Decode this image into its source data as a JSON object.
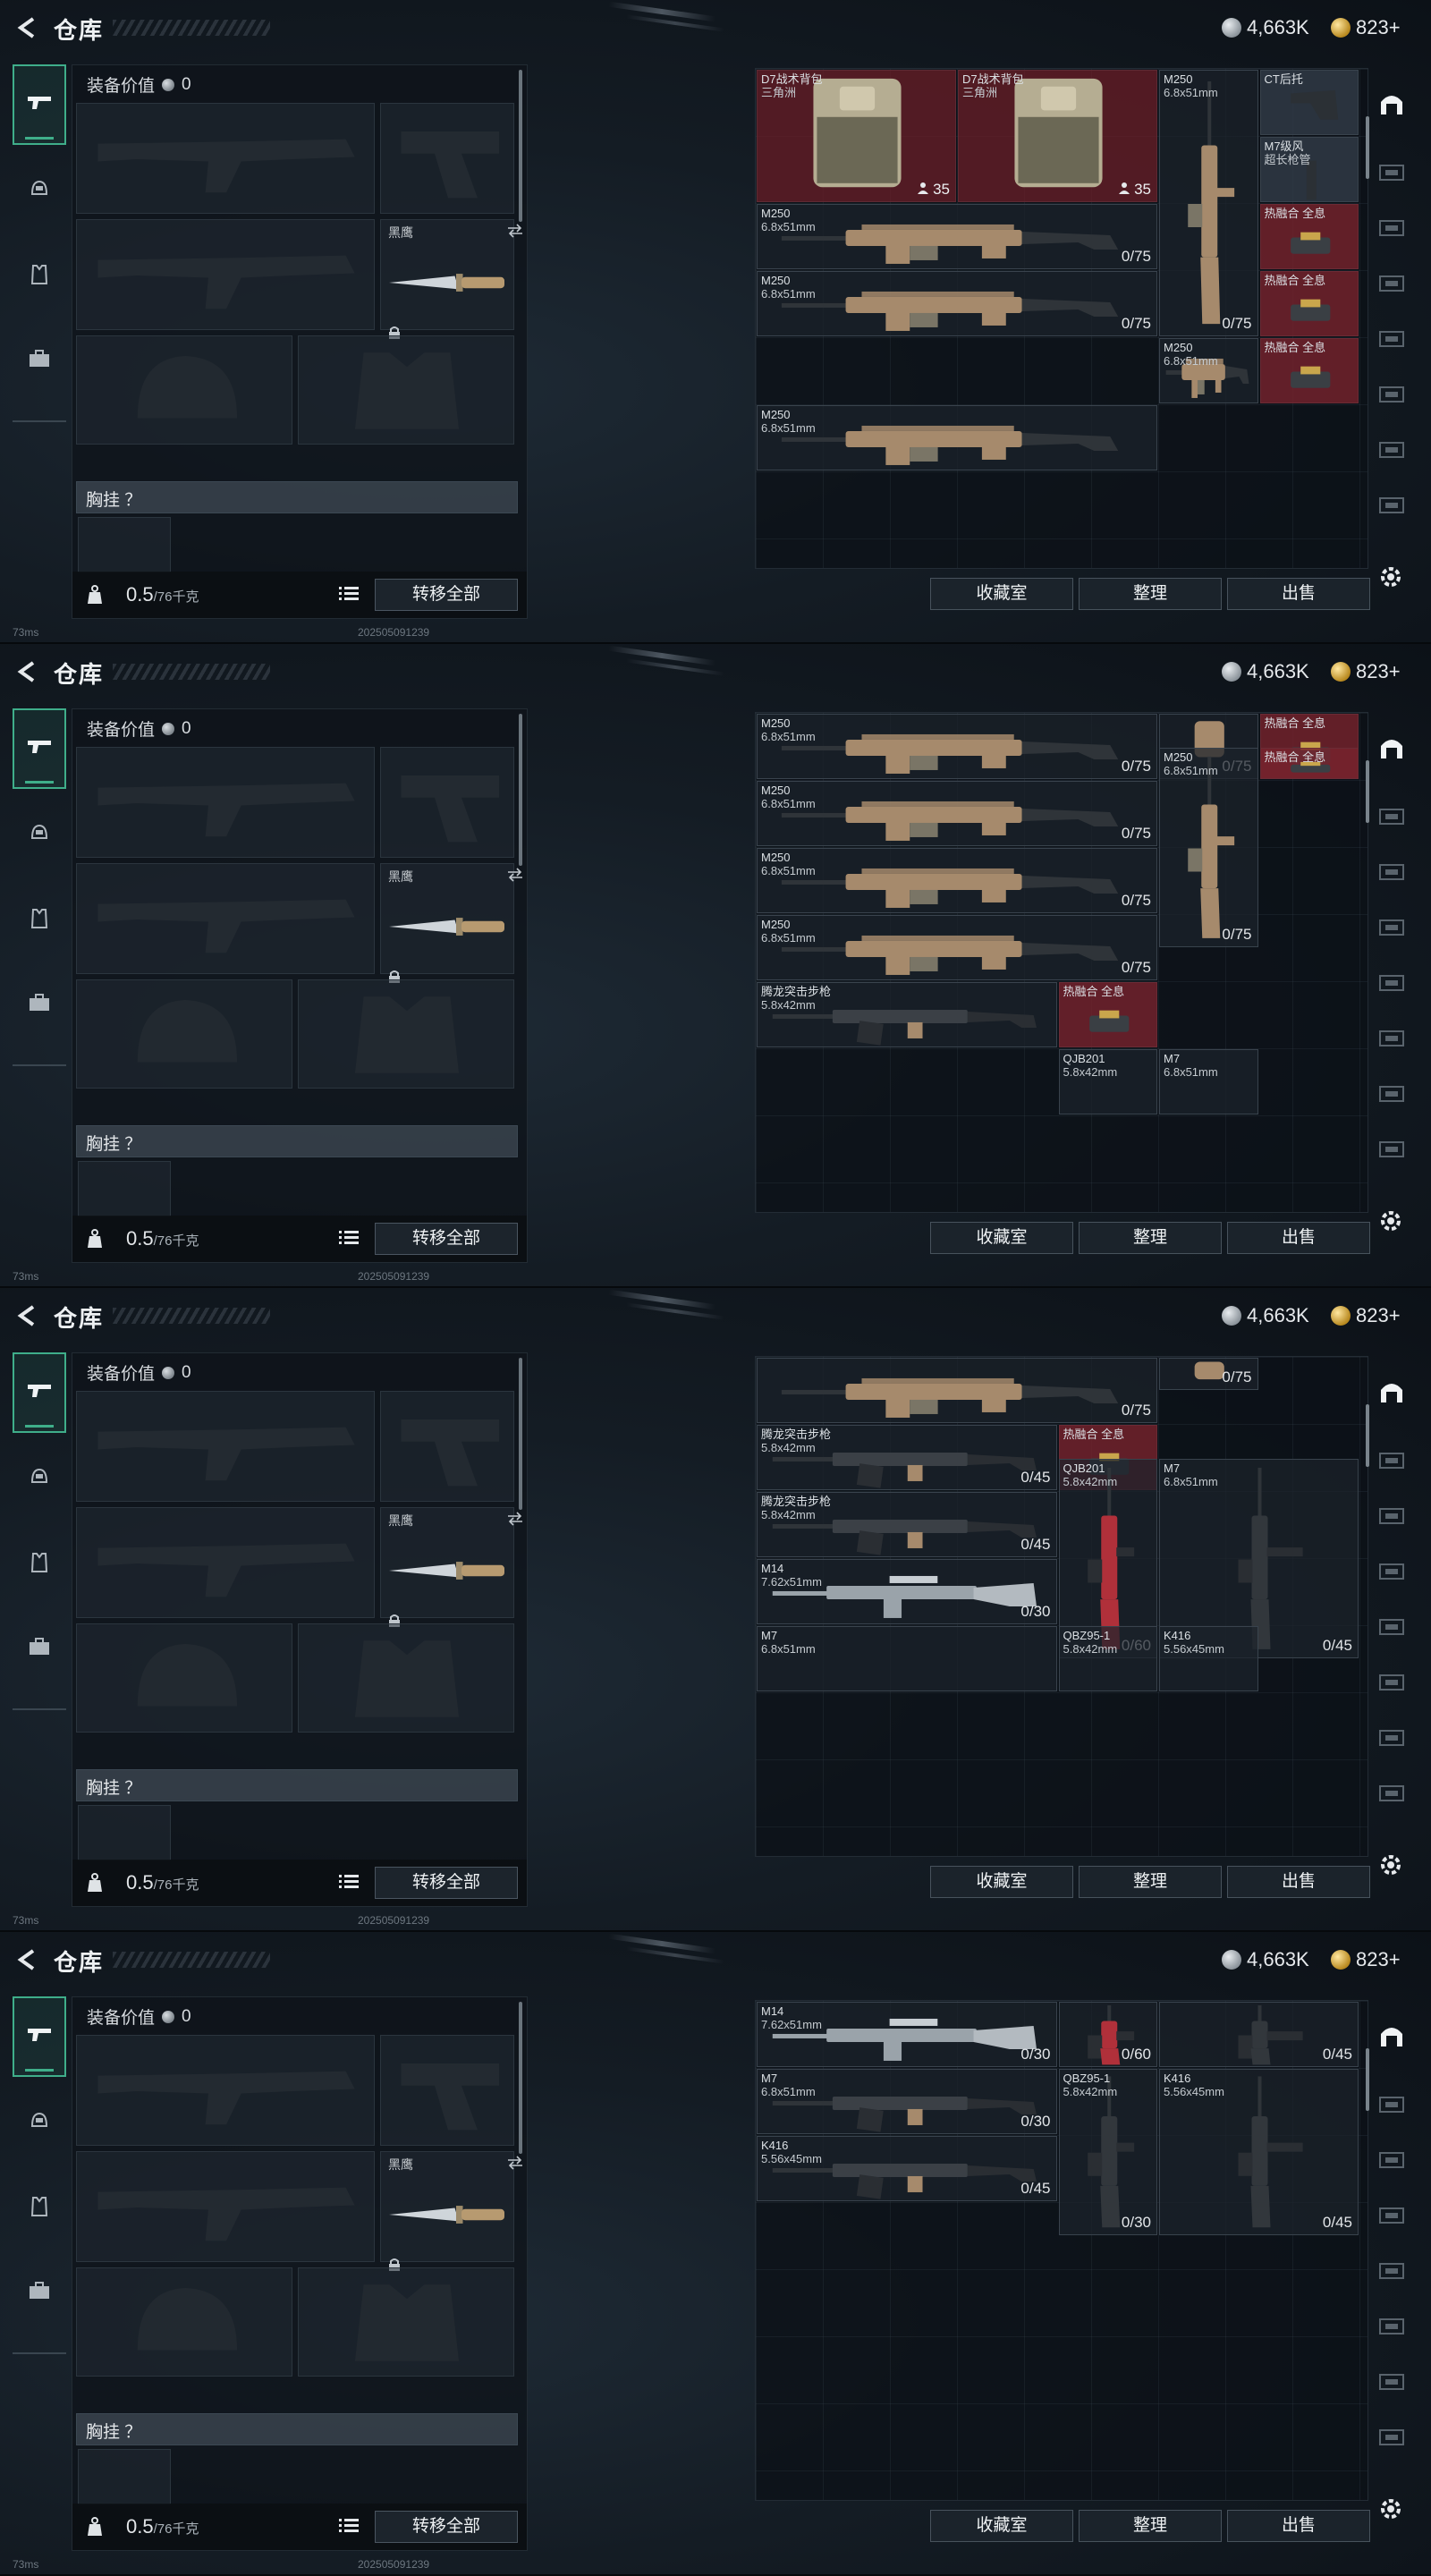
{
  "header": {
    "title": "仓库",
    "silver": "4,663K",
    "gold": "823+"
  },
  "equipment": {
    "value_label": "装备价值",
    "value": "0",
    "knife_label": "黑鹰",
    "vest_label": "胸挂 ？",
    "weight": "0.5",
    "weight_max": "/76千克",
    "transfer_all": "转移全部"
  },
  "buttons": {
    "collection": "收藏室",
    "sort": "整理",
    "sell": "出售"
  },
  "status": {
    "ping": "73ms",
    "build": "202505091239"
  },
  "frames": [
    {
      "items": [
        {
          "name": "D7战术背包",
          "cal": "三角洲",
          "cnt": "35",
          "kind": "backpack",
          "red": true
        },
        {
          "name": "D7战术背包",
          "cal": "三角洲",
          "cnt": "35",
          "kind": "backpack",
          "red": true
        },
        {
          "name": "M250",
          "cal": "6.8x51mm",
          "cnt": "0/75",
          "kind": "lmg-v"
        },
        {
          "name": "CT后托",
          "cal": "",
          "cnt": "",
          "kind": "stock",
          "gray": true
        },
        {
          "name": "M7级风",
          "cal": "超长枪管",
          "cnt": "",
          "kind": "barrel",
          "gray": true
        },
        {
          "name": "M250",
          "cal": "6.8x51mm",
          "cnt": "0/75",
          "kind": "lmg"
        },
        {
          "name": "热融合 全息",
          "cal": "",
          "cnt": "",
          "kind": "sight",
          "fusion": true
        },
        {
          "name": "热融合 全息",
          "cal": "",
          "cnt": "",
          "kind": "sight",
          "fusion": true
        },
        {
          "name": "M250",
          "cal": "6.8x51mm",
          "cnt": "0/75",
          "kind": "lmg"
        },
        {
          "name": "热融合 全息",
          "cal": "",
          "cnt": "",
          "kind": "sight",
          "fusion": true
        },
        {
          "name": "M250",
          "cal": "6.8x51mm",
          "cnt": "",
          "kind": "lmg-v2"
        },
        {
          "name": "M250",
          "cal": "6.8x51mm",
          "cnt": "",
          "kind": "lmg"
        }
      ]
    },
    {
      "items": [
        {
          "name": "M250",
          "cal": "6.8x51mm",
          "cnt": "0/75",
          "kind": "lmg"
        },
        {
          "name": "",
          "cal": "",
          "cnt": "0/75",
          "kind": "part"
        },
        {
          "name": "热融合 全息",
          "cal": "",
          "cnt": "",
          "kind": "sight",
          "fusion": true
        },
        {
          "name": "热融合 全息",
          "cal": "",
          "cnt": "",
          "kind": "sight",
          "fusion": true
        },
        {
          "name": "M250",
          "cal": "6.8x51mm",
          "cnt": "0/75",
          "kind": "lmg-v"
        },
        {
          "name": "M250",
          "cal": "6.8x51mm",
          "cnt": "0/75",
          "kind": "lmg"
        },
        {
          "name": "M250",
          "cal": "6.8x51mm",
          "cnt": "0/75",
          "kind": "lmg"
        },
        {
          "name": "M250",
          "cal": "6.8x51mm",
          "cnt": "0/75",
          "kind": "lmg"
        },
        {
          "name": "腾龙突击步枪",
          "cal": "5.8x42mm",
          "cnt": "",
          "kind": "ar"
        },
        {
          "name": "热融合 全息",
          "cal": "",
          "cnt": "",
          "kind": "sight",
          "fusion": true
        },
        {
          "name": "QJB201",
          "cal": "5.8x42mm",
          "cnt": "",
          "kind": "none"
        },
        {
          "name": "M7",
          "cal": "6.8x51mm",
          "cnt": "",
          "kind": "none"
        }
      ]
    },
    {
      "items": [
        {
          "name": "",
          "cal": "",
          "cnt": "0/75",
          "kind": "lmg"
        },
        {
          "name": "",
          "cal": "",
          "cnt": "0/75",
          "kind": "part"
        },
        {
          "name": "腾龙突击步枪",
          "cal": "5.8x42mm",
          "cnt": "0/45",
          "kind": "ar"
        },
        {
          "name": "热融合 全息",
          "cal": "",
          "cnt": "",
          "kind": "sight",
          "fusion": true
        },
        {
          "name": "QJB201",
          "cal": "5.8x42mm",
          "cnt": "0/60",
          "kind": "red-v"
        },
        {
          "name": "M7",
          "cal": "6.8x51mm",
          "cnt": "0/45",
          "kind": "ar-v"
        },
        {
          "name": "腾龙突击步枪",
          "cal": "5.8x42mm",
          "cnt": "0/45",
          "kind": "ar"
        },
        {
          "name": "M14",
          "cal": "7.62x51mm",
          "cnt": "0/30",
          "kind": "dmr"
        },
        {
          "name": "M7",
          "cal": "6.8x51mm",
          "cnt": "",
          "kind": "none"
        },
        {
          "name": "QBZ95-1",
          "cal": "5.8x42mm",
          "cnt": "",
          "kind": "none"
        },
        {
          "name": "K416",
          "cal": "5.56x45mm",
          "cnt": "",
          "kind": "none"
        }
      ]
    },
    {
      "items": [
        {
          "name": "M14",
          "cal": "7.62x51mm",
          "cnt": "0/30",
          "kind": "dmr"
        },
        {
          "name": "",
          "cal": "",
          "cnt": "0/60",
          "kind": "red-v"
        },
        {
          "name": "",
          "cal": "",
          "cnt": "0/45",
          "kind": "ar-v"
        },
        {
          "name": "M7",
          "cal": "6.8x51mm",
          "cnt": "0/30",
          "kind": "ar"
        },
        {
          "name": "QBZ95-1",
          "cal": "5.8x42mm",
          "cnt": "0/30",
          "kind": "bullpup-v"
        },
        {
          "name": "K416",
          "cal": "5.56x45mm",
          "cnt": "0/45",
          "kind": "ar-v"
        },
        {
          "name": "K416",
          "cal": "5.56x45mm",
          "cnt": "0/45",
          "kind": "ar"
        }
      ]
    }
  ],
  "colors": {
    "accent": "#3fae8a",
    "rare_red": "#6e1e28",
    "fusion": "#782d2d"
  },
  "icons": [
    "back-arrow-icon",
    "silver-coin-icon",
    "gold-coin-icon",
    "weapon-tab-icon",
    "helmet-tab-icon",
    "vest-tab-icon",
    "case-tab-icon",
    "swap-icon",
    "lock-icon",
    "weight-icon",
    "list-icon",
    "gear-icon"
  ]
}
